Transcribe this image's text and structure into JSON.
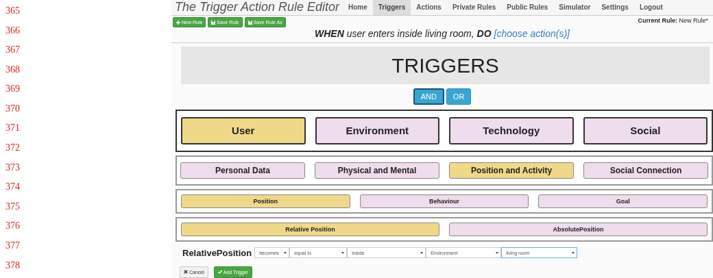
{
  "line_numbers": [
    "365",
    "366",
    "367",
    "368",
    "369",
    "370",
    "371",
    "372",
    "373",
    "374",
    "375",
    "376",
    "377",
    "378"
  ],
  "app": {
    "title": "The Trigger Action Rule Editor",
    "nav": [
      {
        "label": "Home",
        "selected": false
      },
      {
        "label": "Triggers",
        "selected": true
      },
      {
        "label": "Actions",
        "selected": false
      },
      {
        "label": "Private Rules",
        "selected": false
      },
      {
        "label": "Public Rules",
        "selected": false
      },
      {
        "label": "Simulator",
        "selected": false
      },
      {
        "label": "Settings",
        "selected": false
      },
      {
        "label": "Logout",
        "selected": false
      }
    ],
    "toolbar": [
      {
        "label": "New Rule",
        "kind": "new"
      },
      {
        "label": "Save Rule",
        "kind": "save"
      },
      {
        "label": "Save Rule As",
        "kind": "save"
      }
    ],
    "current_rule": {
      "label": "Current Rule:",
      "value": "New Rule*"
    },
    "rule": {
      "text": "**WHEN** user enters inside living room, **DO**",
      "link": "[choose action(s)]"
    },
    "heading": "TRIGGERS",
    "operators": [
      {
        "label": "AND",
        "selected": true
      },
      {
        "label": "OR",
        "selected": false
      }
    ],
    "levels": [
      [
        {
          "label": "User",
          "selected": true
        },
        {
          "label": "Environment",
          "selected": false
        },
        {
          "label": "Technology",
          "selected": false
        },
        {
          "label": "Social",
          "selected": false
        }
      ],
      [
        {
          "label": "Personal Data",
          "selected": false
        },
        {
          "label": "Physical and Mental",
          "selected": false
        },
        {
          "label": "Position and Activity",
          "selected": true
        },
        {
          "label": "Social Connection",
          "selected": false
        }
      ],
      [
        {
          "label": "Position",
          "selected": true
        },
        {
          "label": "Behaviour",
          "selected": false
        },
        {
          "label": "Goal",
          "selected": false
        }
      ],
      [
        {
          "label": "Relative Position",
          "selected": true
        },
        {
          "label": "AbsolutePosition",
          "selected": false
        }
      ]
    ],
    "condition": {
      "name": "RelativePosition",
      "selects": [
        {
          "value": "becomes",
          "focused": false
        },
        {
          "value": "equal to",
          "focused": false
        },
        {
          "value": "inside",
          "focused": false
        },
        {
          "value": "Environment",
          "focused": false
        },
        {
          "value": "living room",
          "focused": true
        }
      ]
    },
    "actions": [
      {
        "label": "Cancel",
        "kind": "cancel"
      },
      {
        "label": "Add Trigger",
        "kind": "add"
      }
    ]
  }
}
